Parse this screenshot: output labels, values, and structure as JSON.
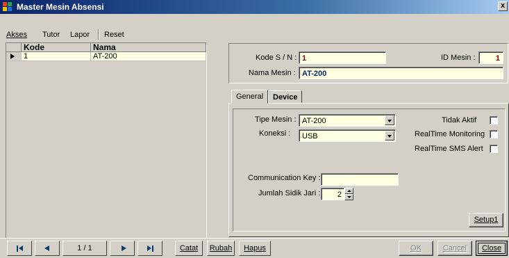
{
  "window": {
    "title": "Master Mesin Absensi",
    "close_glyph": "x"
  },
  "menu": {
    "items": [
      "Akses",
      "Tutor",
      "Lapor"
    ],
    "reset": "Reset"
  },
  "grid": {
    "columns": [
      "Kode",
      "Nama"
    ],
    "rows": [
      {
        "kode": "1",
        "nama": "AT-200"
      }
    ]
  },
  "form": {
    "kode_sn_label": "Kode S / N :",
    "kode_sn_value": "1",
    "id_mesin_label": "ID Mesin :",
    "id_mesin_value": "1",
    "nama_mesin_label": "Nama Mesin :",
    "nama_mesin_value": "AT-200"
  },
  "tabs": [
    "General",
    "Device"
  ],
  "general": {
    "tipe_mesin_label": "Tipe Mesin :",
    "tipe_mesin_value": "AT-200",
    "koneksi_label": "Koneksi :",
    "koneksi_value": "USB",
    "tidak_aktif_label": "Tidak Aktif",
    "realtime_monitoring_label": "RealTime Monitoring",
    "realtime_sms_label": "RealTime SMS Alert",
    "comm_key_label": "Communication Key :",
    "comm_key_value": "",
    "jumlah_sidik_label": "Jumlah Sidik Jari :",
    "jumlah_sidik_value": "2",
    "setup_button": "Setup1"
  },
  "footer": {
    "record_position": "1 / 1",
    "catat": "Catat",
    "rubah": "Rubah",
    "hapus": "Hapus",
    "ok": "OK",
    "cancel": "Cancel",
    "close": "Close"
  },
  "colors": {
    "title_bar": "#0a246a",
    "field_bg": "#ffffe1",
    "value_red": "#8b0000",
    "value_blue": "#0a246a",
    "nav_arrow": "#0a3a6a"
  }
}
